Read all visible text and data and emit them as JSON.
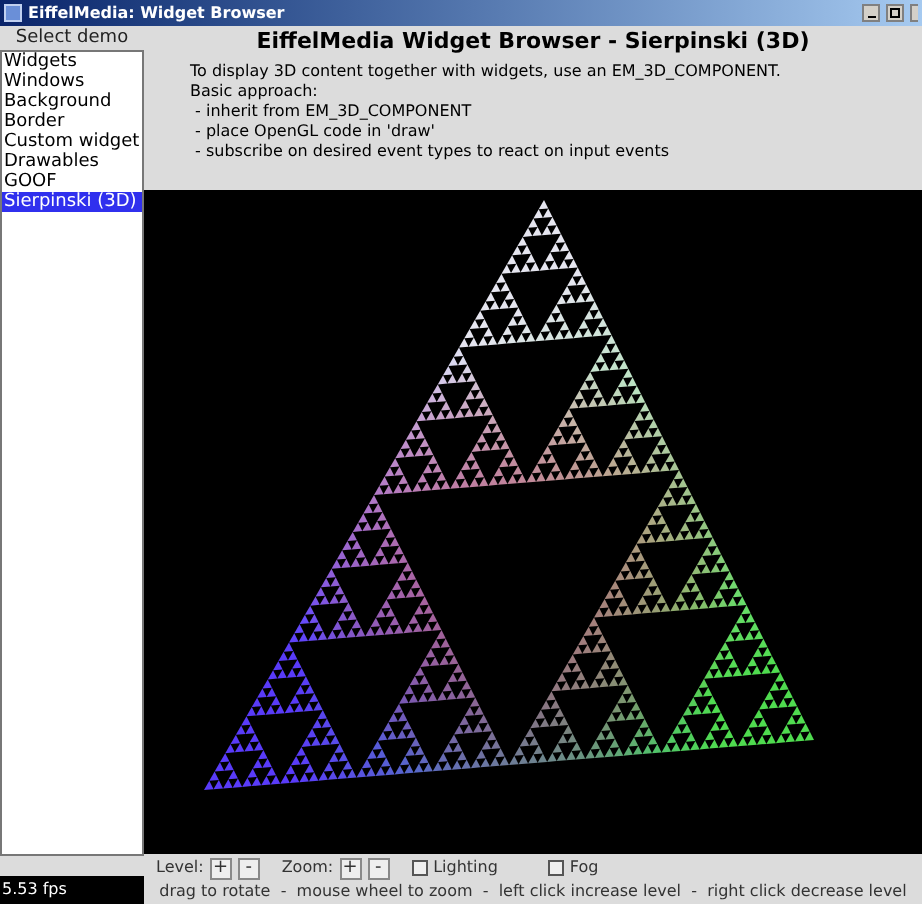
{
  "window": {
    "title": "EiffelMedia: Widget Browser"
  },
  "sidebar": {
    "label": "Select demo",
    "items": [
      {
        "label": "Widgets",
        "selected": false
      },
      {
        "label": "Windows",
        "selected": false
      },
      {
        "label": "Background",
        "selected": false
      },
      {
        "label": "Border",
        "selected": false
      },
      {
        "label": "Custom widget",
        "selected": false
      },
      {
        "label": "Drawables",
        "selected": false
      },
      {
        "label": "GOOF",
        "selected": false
      },
      {
        "label": "Sierpinski (3D)",
        "selected": true
      }
    ],
    "fps": "5.53 fps"
  },
  "main": {
    "heading": "EiffelMedia Widget Browser - Sierpinski (3D)",
    "description": [
      "To display 3D content together with widgets, use an EM_3D_COMPONENT.",
      "Basic approach:",
      " - inherit from EM_3D_COMPONENT",
      " - place OpenGL code in 'draw'",
      " - subscribe on desired event types to react on input events"
    ],
    "controls": {
      "level_label": "Level:",
      "zoom_label": "Zoom:",
      "plus": "+",
      "minus": "-",
      "checkboxes": [
        {
          "label": "Lighting",
          "checked": false
        },
        {
          "label": "Fog",
          "checked": false
        }
      ]
    },
    "hint": "drag to rotate  -  mouse wheel to zoom  -  left click increase level  -  right click decrease level"
  }
}
